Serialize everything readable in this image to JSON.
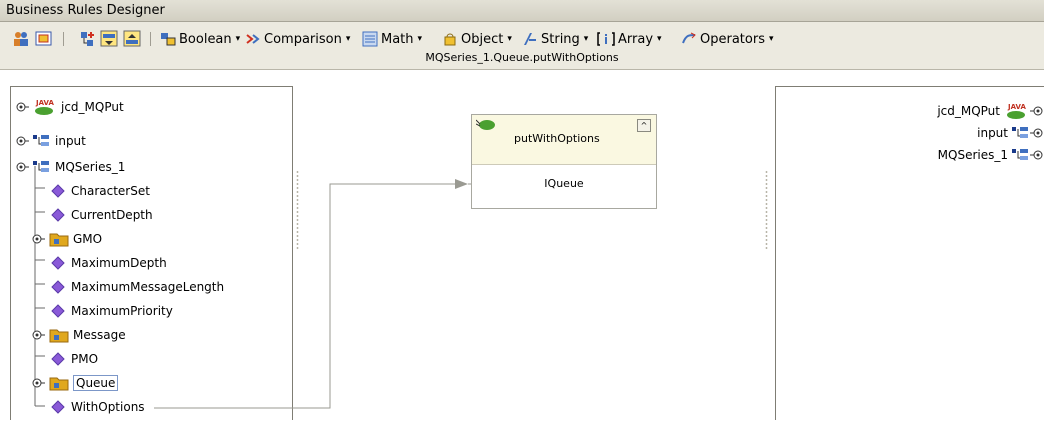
{
  "window": {
    "title": "Business Rules Designer"
  },
  "toolbar": {
    "menus": [
      {
        "label": "Boolean"
      },
      {
        "label": "Comparison"
      },
      {
        "label": "Math"
      },
      {
        "label": "Object"
      },
      {
        "label": "String"
      },
      {
        "label": "Array"
      },
      {
        "label": "Operators"
      }
    ],
    "dropdown_arrow": "▾"
  },
  "canvas": {
    "title": "MQSeries_1.Queue.putWithOptions"
  },
  "left_tree": {
    "items": [
      {
        "label": "jcd_MQPut",
        "icon": "java-collab-icon"
      },
      {
        "label": "input",
        "icon": "tree-node-icon"
      },
      {
        "label": "MQSeries_1",
        "icon": "tree-node-icon"
      },
      {
        "label": "CharacterSet",
        "icon": "diamond-icon"
      },
      {
        "label": "CurrentDepth",
        "icon": "diamond-icon"
      },
      {
        "label": "GMO",
        "icon": "folder-icon"
      },
      {
        "label": "MaximumDepth",
        "icon": "diamond-icon"
      },
      {
        "label": "MaximumMessageLength",
        "icon": "diamond-icon"
      },
      {
        "label": "MaximumPriority",
        "icon": "diamond-icon"
      },
      {
        "label": "Message",
        "icon": "folder-icon"
      },
      {
        "label": "PMO",
        "icon": "diamond-icon"
      },
      {
        "label": "Queue",
        "icon": "folder-icon",
        "selected": true
      },
      {
        "label": "WithOptions",
        "icon": "diamond-icon"
      }
    ],
    "java_badge": "JAVA"
  },
  "method_node": {
    "title": "putWithOptions",
    "port": "IQueue",
    "collapse_glyph": "^"
  },
  "right_tree": {
    "items": [
      {
        "label": "jcd_MQPut"
      },
      {
        "label": "input"
      },
      {
        "label": "MQSeries_1"
      }
    ]
  },
  "colors": {
    "diamond": "#8a5ad8",
    "folder": "#e0a81e",
    "connector": "#9a9a92"
  }
}
